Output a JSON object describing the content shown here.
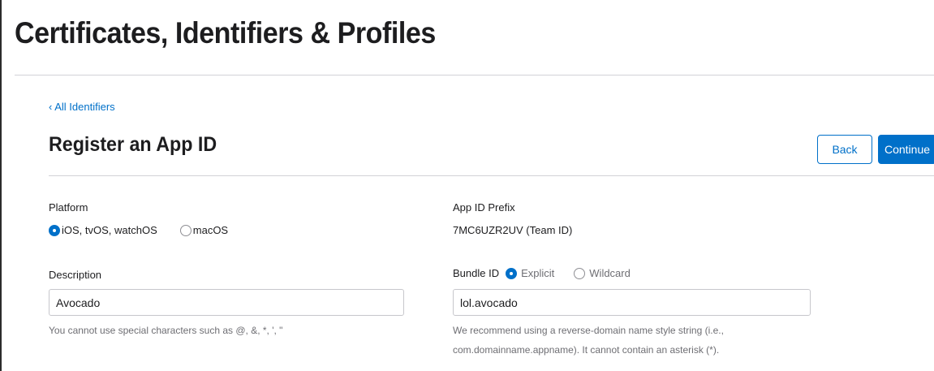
{
  "header": {
    "title": "Certificates, Identifiers & Profiles"
  },
  "nav": {
    "back_link": "‹ All Identifiers"
  },
  "page": {
    "title": "Register an App ID",
    "back_button": "Back",
    "continue_button": "Continue"
  },
  "platform": {
    "label": "Platform",
    "options": [
      {
        "label": "iOS, tvOS, watchOS",
        "selected": true
      },
      {
        "label": "macOS",
        "selected": false
      }
    ]
  },
  "app_id_prefix": {
    "label": "App ID Prefix",
    "value": "7MC6UZR2UV (Team ID)"
  },
  "description": {
    "label": "Description",
    "value": "Avocado",
    "hint": "You cannot use special characters such as @, &, *, ', \""
  },
  "bundle_id": {
    "label": "Bundle ID",
    "options": [
      {
        "label": "Explicit",
        "selected": true
      },
      {
        "label": "Wildcard",
        "selected": false
      }
    ],
    "value": "lol.avocado",
    "hint_line1": "We recommend using a reverse-domain name style string (i.e.,",
    "hint_line2": "com.domainname.appname). It cannot contain an asterisk (*)."
  },
  "colors": {
    "accent": "#0070c9",
    "text": "#1d1d1f",
    "muted": "#6e6e73",
    "rule": "#d2d2d7"
  }
}
